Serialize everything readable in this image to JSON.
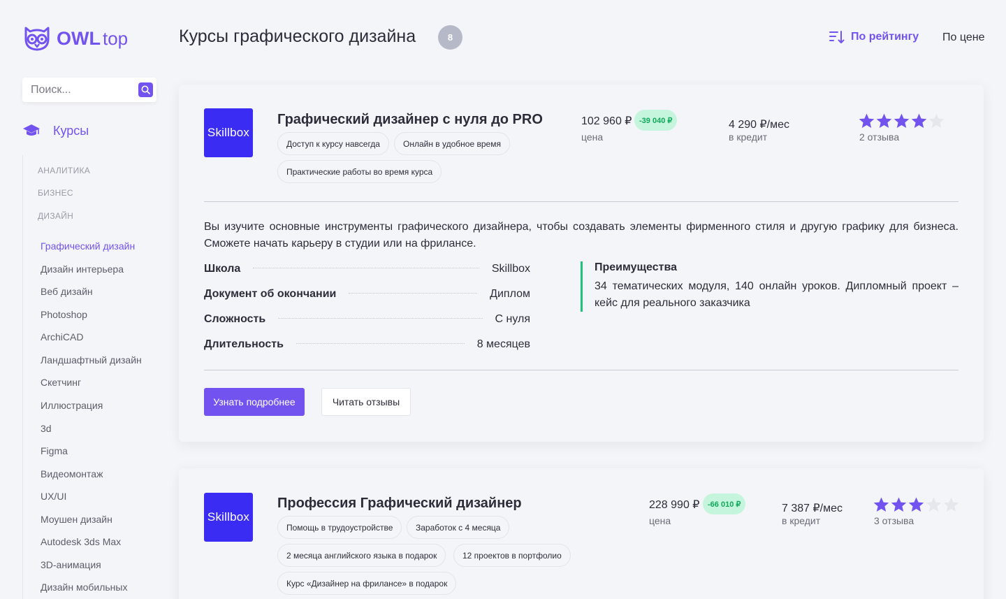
{
  "brand": {
    "owl": "OWL",
    "top": "top"
  },
  "search": {
    "placeholder": "Поиск..."
  },
  "sidebar": {
    "courses_label": "Курсы",
    "groups": [
      "АНАЛИТИКА",
      "БИЗНЕС",
      "ДИЗАЙН"
    ],
    "items": [
      "Графический дизайн",
      "Дизайн интерьера",
      "Веб дизайн",
      "Photoshop",
      "ArchiCAD",
      "Ландшафтный дизайн",
      "Скетчинг",
      "Иллюстрация",
      "3d",
      "Figma",
      "Видеомонтаж",
      "UX/UI",
      "Моушен дизайн",
      "Autodesk 3ds Max",
      "3D-анимация",
      "Дизайн мобильных"
    ],
    "active_item": "Графический дизайн"
  },
  "header": {
    "title": "Курсы графического дизайна",
    "count": "8",
    "sort_rating": "По рейтингу",
    "sort_price": "По цене"
  },
  "courses": [
    {
      "school": "Skillbox",
      "title": "Графический дизайнер с нуля до PRO",
      "tags": [
        "Доступ к курсу навсегда",
        "Онлайн в удобное время",
        "Практические работы во время курса"
      ],
      "price": "102 960 ₽",
      "discount": "-39 040 ₽",
      "price_label": "цена",
      "credit": "4 290 ₽/мес",
      "credit_label": "в кредит",
      "rating": 4,
      "reviews": "2 отзыва",
      "description": "Вы изучите основные инструменты графического дизайнера, чтобы создавать элементы фирменного стиля и другую графику для бизнеса. Сможете начать карьеру в студии или на фрилансе.",
      "specs": [
        {
          "label": "Школа",
          "value": "Skillbox"
        },
        {
          "label": "Документ об окончании",
          "value": "Диплом"
        },
        {
          "label": "Сложность",
          "value": "С нуля"
        },
        {
          "label": "Длительность",
          "value": "8 месяцев"
        }
      ],
      "advantages_title": "Преимущества",
      "advantages_text": "34 тематических модуля, 140 онлайн уроков. Дипломный проект – кейс для реального заказчика",
      "btn_more": "Узнать подробнее",
      "btn_reviews": "Читать отзывы"
    },
    {
      "school": "Skillbox",
      "title": "Профессия Графический дизайнер",
      "tags": [
        "Помощь в трудоустройстве",
        "Заработок с 4 месяца",
        "2 месяца английского языка в подарок",
        "12 проектов в портфолио",
        "Курс «Дизайнер на фрилансе» в подарок"
      ],
      "price": "228 990 ₽",
      "discount": "-66 010 ₽",
      "price_label": "цена",
      "credit": "7 387 ₽/мес",
      "credit_label": "в кредит",
      "rating": 3,
      "reviews": "3 отзыва"
    }
  ],
  "colors": {
    "accent": "#7353f0",
    "school_logo": "#3a2cf2",
    "discount_bg": "#c5f5dd",
    "discount_text": "#10a85a",
    "advantage_border": "#21c27a",
    "star_empty": "#e6e7ec"
  }
}
